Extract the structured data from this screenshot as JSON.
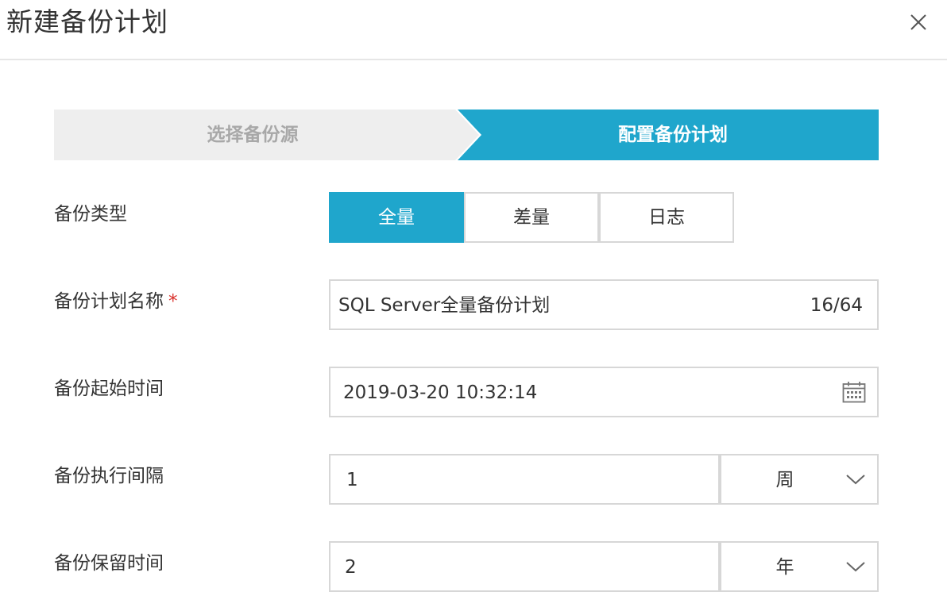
{
  "dialog": {
    "title": "新建备份计划"
  },
  "steps": [
    {
      "label": "选择备份源",
      "state": "done"
    },
    {
      "label": "配置备份计划",
      "state": "active"
    }
  ],
  "form": {
    "backup_type": {
      "label": "备份类型",
      "options": [
        "全量",
        "差量",
        "日志"
      ],
      "selected": "全量"
    },
    "plan_name": {
      "label": "备份计划名称",
      "required_mark": "*",
      "value": "SQL Server全量备份计划",
      "counter": "16/64"
    },
    "start_time": {
      "label": "备份起始时间",
      "value": "2019-03-20 10:32:14"
    },
    "interval": {
      "label": "备份执行间隔",
      "value": "1",
      "unit": "周"
    },
    "retention": {
      "label": "备份保留时间",
      "value": "2",
      "unit": "年"
    }
  },
  "colors": {
    "accent": "#1fa6cc",
    "step_inactive_bg": "#eeeeee",
    "border": "#d7d7d7",
    "required": "#d9302b"
  },
  "icons": {
    "close": "close-icon",
    "calendar": "calendar-icon",
    "dropdown": "chevron-down-icon"
  }
}
